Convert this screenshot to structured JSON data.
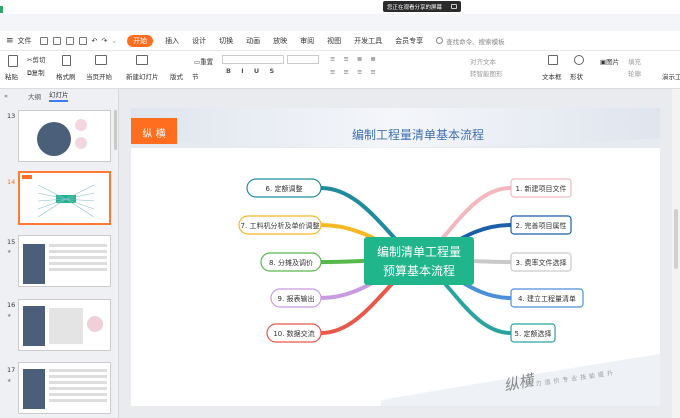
{
  "app": {
    "screen_share_notice": "您正在观看分享的屏幕"
  },
  "menu": {
    "file": "文件",
    "tabs": [
      "开始",
      "插入",
      "设计",
      "切换",
      "动画",
      "放映",
      "审阅",
      "视图",
      "开发工具",
      "会员专享"
    ],
    "search_placeholder": "查找命令、搜索模板"
  },
  "ribbon": {
    "paste": "粘贴",
    "cut": "剪切",
    "copy": "复制",
    "format_painter": "格式刷",
    "play_from_current": "当页开始",
    "new_slide": "新建幻灯片",
    "layout": "版式",
    "section": "节",
    "reset": "重置",
    "align_text": "对齐文本",
    "smartart": "转智能图形",
    "textbox": "文本框",
    "shape": "形状",
    "picture": "图片",
    "fill": "填充",
    "outline": "轮廓",
    "presenter": "演示工"
  },
  "left_panel": {
    "tab_outline": "大纲",
    "tab_slides": "幻灯片",
    "slide_numbers": [
      "13",
      "14",
      "15",
      "16",
      "17"
    ]
  },
  "slide": {
    "logo": "纵 横",
    "title": "编制工程量清单基本流程",
    "center": [
      "编制清单工程量",
      "预算基本流程"
    ],
    "left_nodes": [
      "6. 定额调整",
      "7. 工料机分析及单价调整",
      "8. 分摊及调价",
      "9. 报表输出",
      "10. 数据交流"
    ],
    "right_nodes": [
      "1. 新建项目文件",
      "2. 完善项目属性",
      "3. 费率文件选择",
      "4. 建立工程量清单",
      "5. 定额选择"
    ],
    "left_colors": [
      "#1f8a9b",
      "#f5b825",
      "#57b94c",
      "#c89be0",
      "#e8574a"
    ],
    "right_colors": [
      "#f3b7bf",
      "#1a5fa8",
      "#c9c9c9",
      "#4a8fd8",
      "#2aa3a0"
    ],
    "center_color": "#20b58a",
    "signature": "纵横",
    "footer_text": "助力造价专业技能提升"
  }
}
